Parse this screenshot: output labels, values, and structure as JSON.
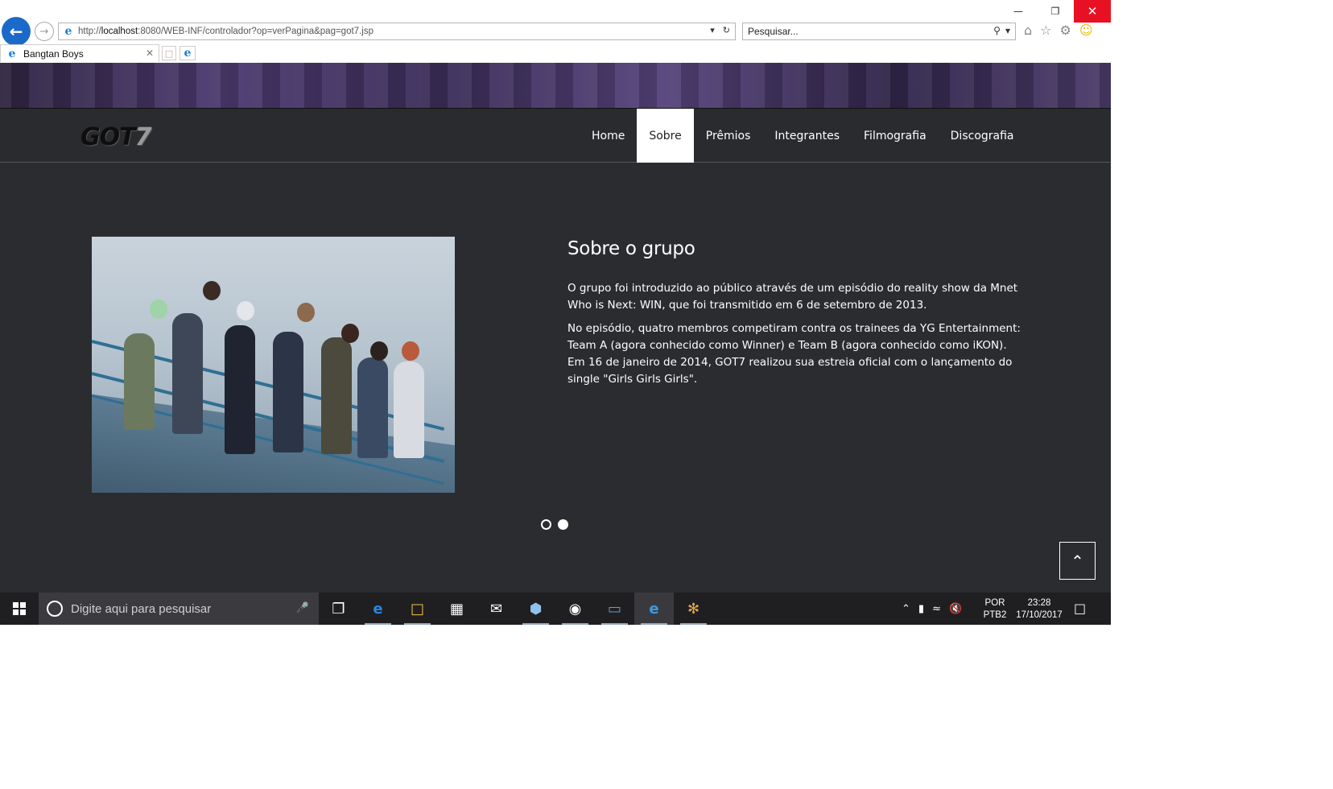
{
  "browser": {
    "url_prefix": "http://",
    "url_host": "localhost",
    "url_rest": ":8080/WEB-INF/controlador?op=verPagina&pag=got7.jsp",
    "search_placeholder": "Pesquisar...",
    "tab_title": "Bangtan Boys"
  },
  "site": {
    "logo_main": "GOT",
    "logo_num": "7",
    "nav": [
      {
        "label": "Home",
        "active": false
      },
      {
        "label": "Sobre",
        "active": true
      },
      {
        "label": "Prêmios",
        "active": false
      },
      {
        "label": "Integrantes",
        "active": false
      },
      {
        "label": "Filmografia",
        "active": false
      },
      {
        "label": "Discografia",
        "active": false
      }
    ],
    "about": {
      "title": "Sobre o grupo",
      "p1": "O grupo foi introduzido ao público através de um episódio do reality show da Mnet Who is Next: WIN, que foi transmitido em 6 de setembro de 2013.",
      "p2": "No episódio, quatro membros competiram contra os trainees da YG Entertainment: Team A (agora conhecido como Winner) e Team B (agora conhecido como iKON). Em 16 de janeiro de 2014, GOT7 realizou sua estreia oficial com o lançamento do single \"Girls Girls Girls\"."
    },
    "carousel": {
      "slides": 2,
      "active_index": 1
    }
  },
  "taskbar": {
    "search_placeholder": "Digite aqui para pesquisar",
    "lang_line1": "POR",
    "lang_line2": "PTB2",
    "time": "23:28",
    "date": "17/10/2017"
  },
  "colors": {
    "page_bg": "#2b2c30",
    "ie_blue": "#1b6ac9",
    "close_red": "#e81123",
    "taskbar": "#1f1f22"
  }
}
